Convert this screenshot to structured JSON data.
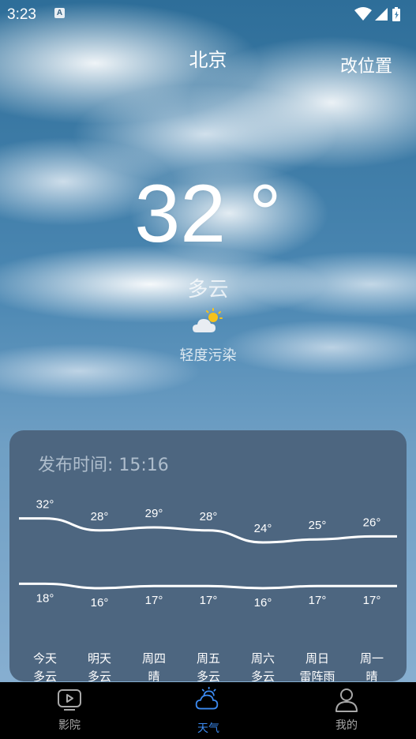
{
  "status_bar": {
    "time": "3:23",
    "notification_icon": "a-letter-icon",
    "icons": [
      "wifi-icon",
      "signal-icon",
      "battery-icon"
    ]
  },
  "header": {
    "city": "北京",
    "change_location_label": "改位置"
  },
  "current": {
    "temperature": "32 °",
    "condition": "多云",
    "condition_icon": "partly-cloudy-icon",
    "air_quality": "轻度污染"
  },
  "forecast": {
    "publish_time": "发布时间: 15:16",
    "days": [
      {
        "day": "今天",
        "condition": "多云",
        "high": 32,
        "low": 18,
        "high_label": "32°",
        "low_label": "18°"
      },
      {
        "day": "明天",
        "condition": "多云",
        "high": 28,
        "low": 16,
        "high_label": "28°",
        "low_label": "16°"
      },
      {
        "day": "周四",
        "condition": "晴",
        "high": 29,
        "low": 17,
        "high_label": "29°",
        "low_label": "17°"
      },
      {
        "day": "周五",
        "condition": "多云",
        "high": 28,
        "low": 17,
        "high_label": "28°",
        "low_label": "17°"
      },
      {
        "day": "周六",
        "condition": "多云",
        "high": 24,
        "low": 16,
        "high_label": "24°",
        "low_label": "16°"
      },
      {
        "day": "周日",
        "condition": "雷阵雨",
        "high": 25,
        "low": 17,
        "high_label": "25°",
        "low_label": "17°"
      },
      {
        "day": "周一",
        "condition": "晴",
        "high": 26,
        "low": 17,
        "high_label": "26°",
        "low_label": "17°"
      }
    ]
  },
  "bottom_nav": {
    "items": [
      {
        "label": "影院",
        "icon": "tv-play-icon",
        "active": false
      },
      {
        "label": "天气",
        "icon": "weather-cloud-icon",
        "active": true
      },
      {
        "label": "我的",
        "icon": "user-icon",
        "active": false
      }
    ],
    "active_color": "#3c8bf2",
    "inactive_color": "#a8a8a8"
  }
}
